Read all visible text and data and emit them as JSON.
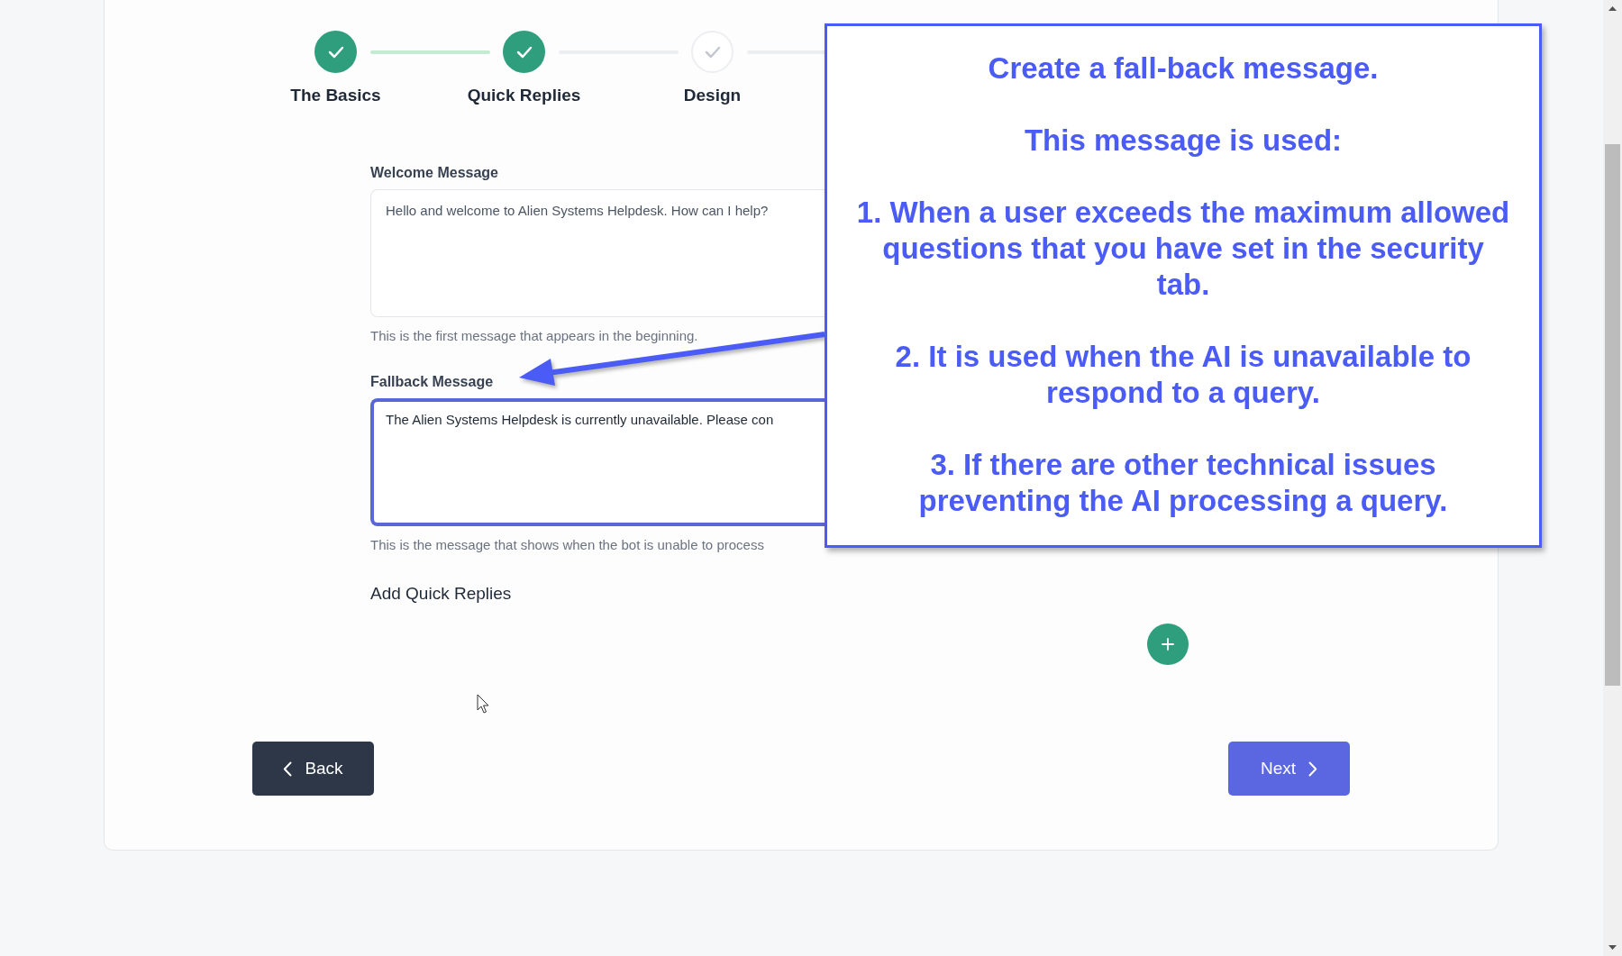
{
  "stepper": {
    "steps": [
      {
        "label": "The Basics",
        "completed": true
      },
      {
        "label": "Quick Replies",
        "completed": true
      },
      {
        "label": "Design",
        "completed": false
      }
    ]
  },
  "fields": [
    {
      "label": "Welcome Message",
      "value": "Hello and welcome to Alien Systems Helpdesk. How can I help?",
      "help": "This is the first message that appears in the beginning.",
      "focused": false
    },
    {
      "label": "Fallback Message",
      "value": "The Alien Systems Helpdesk is currently unavailable. Please con",
      "help": "This is the message that shows when the bot is unable to process",
      "focused": true
    }
  ],
  "quick_replies": {
    "heading": "Add Quick Replies"
  },
  "buttons": [
    {
      "kind": "back",
      "label": "Back"
    },
    {
      "kind": "next",
      "label": "Next"
    }
  ],
  "callout": {
    "title": "Create a fall-back message.",
    "intro": "This message is used:",
    "points": [
      "1. When a user exceeds the maximum allowed questions that you have set in the security tab.",
      "2. It is used when the AI is unavailable to respond to a query.",
      "3. If there are other technical issues preventing the AI processing a query."
    ]
  }
}
